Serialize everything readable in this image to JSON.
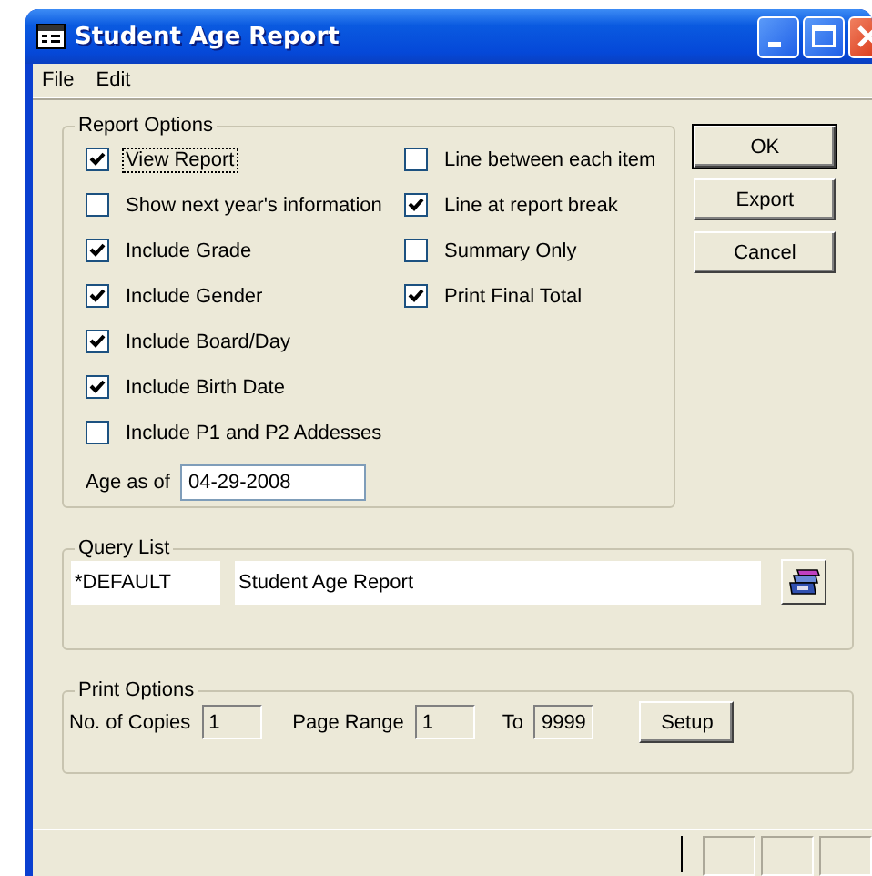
{
  "window": {
    "title": "Student Age Report"
  },
  "menu": [
    "File",
    "Edit"
  ],
  "report_options": {
    "title": "Report Options",
    "left": [
      {
        "label": "View Report",
        "checked": true,
        "focused": true
      },
      {
        "label": "Show next year's information",
        "checked": false,
        "focused": false
      },
      {
        "label": "Include Grade",
        "checked": true,
        "focused": false
      },
      {
        "label": "Include Gender",
        "checked": true,
        "focused": false
      },
      {
        "label": "Include Board/Day",
        "checked": true,
        "focused": false
      },
      {
        "label": "Include Birth Date",
        "checked": true,
        "focused": false
      },
      {
        "label": "Include P1 and P2 Addesses",
        "checked": false,
        "focused": false
      }
    ],
    "right": [
      {
        "label": "Line between each item",
        "checked": false,
        "focused": false
      },
      {
        "label": "Line at report break",
        "checked": true,
        "focused": false
      },
      {
        "label": "Summary Only",
        "checked": false,
        "focused": false
      },
      {
        "label": "Print Final Total",
        "checked": true,
        "focused": false
      }
    ],
    "age_label": "Age as of",
    "age_value": "04-29-2008"
  },
  "buttons": [
    {
      "label": "OK",
      "default": true
    },
    {
      "label": "Export",
      "default": false
    },
    {
      "label": "Cancel",
      "default": false
    }
  ],
  "query_list": {
    "title": "Query List",
    "code": "*DEFAULT",
    "name": "Student Age Report"
  },
  "print_options": {
    "title": "Print Options",
    "copies_label": "No. of Copies",
    "copies": "1",
    "range_label": "Page Range",
    "from": "1",
    "to_label": "To",
    "to": "9999",
    "setup": "Setup"
  }
}
